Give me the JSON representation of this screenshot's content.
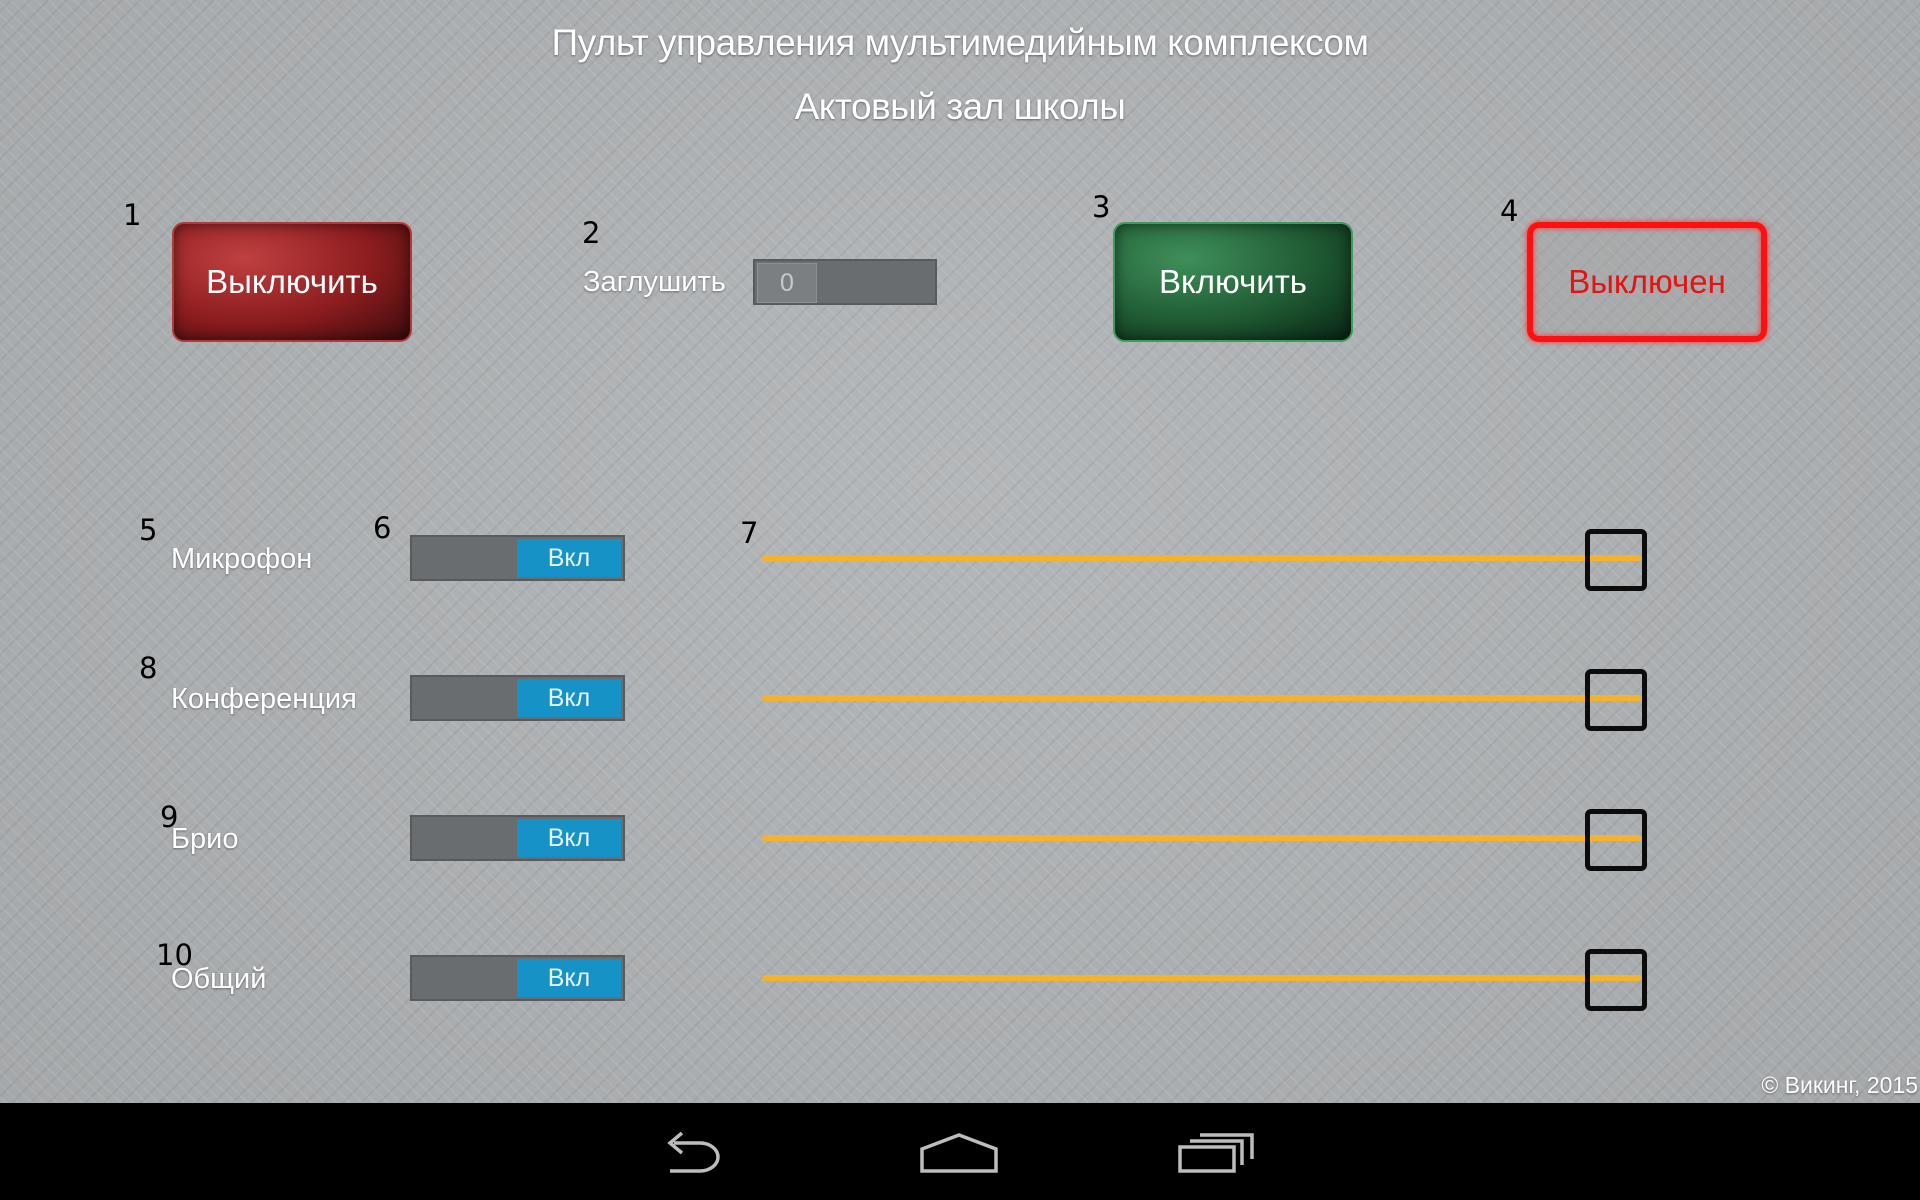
{
  "header": {
    "title": "Пульт управления мультимедийным комплексом",
    "subtitle": "Актовый зал школы"
  },
  "markers": [
    "1",
    "2",
    "3",
    "4",
    "5",
    "6",
    "7",
    "8",
    "9",
    "10"
  ],
  "controls": {
    "power_off_label": "Выключить",
    "mute": {
      "label": "Заглушить",
      "value": "0"
    },
    "power_on_label": "Включить",
    "status_label": "Выключен"
  },
  "channels": [
    {
      "label": "Микрофон",
      "toggle": "Вкл",
      "level": 0.97
    },
    {
      "label": "Конференция",
      "toggle": "Вкл",
      "level": 0.97
    },
    {
      "label": "Брио",
      "toggle": "Вкл",
      "level": 0.97
    },
    {
      "label": "Общий",
      "toggle": "Вкл",
      "level": 0.97
    }
  ],
  "colors": {
    "slider_track": "#f5b22b",
    "toggle_on": "#1792c6",
    "status_red": "#ff1010"
  },
  "footer": {
    "copyright": "© Викинг, 2015"
  },
  "navbar": {
    "icons": [
      "back-icon",
      "home-icon",
      "recents-icon"
    ]
  }
}
